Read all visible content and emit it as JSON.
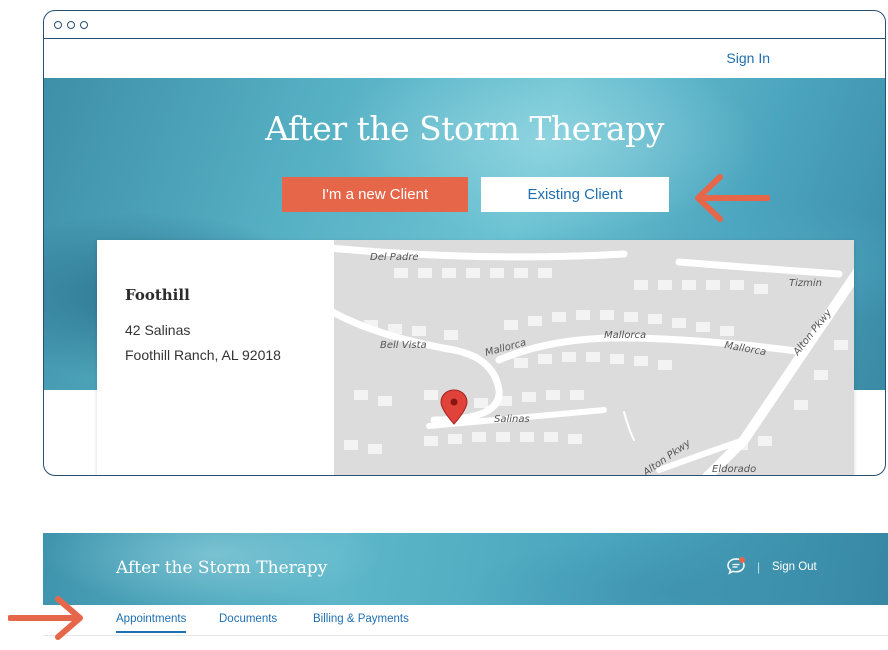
{
  "browser": {
    "topbar": {
      "sign_in": "Sign In"
    },
    "hero": {
      "title": "After the Storm Therapy",
      "new_client_label": "I'm a new Client",
      "existing_client_label": "Existing Client"
    },
    "location": {
      "name": "Foothill",
      "address_line1": "42 Salinas",
      "address_line2": "Foothill Ranch, AL 92018"
    },
    "map": {
      "streets": [
        "Del Padre",
        "Tizmin",
        "Alton Pkwy",
        "Bell Vista",
        "Mallorca",
        "Mallorca",
        "Mallorca",
        "Salinas",
        "Alton Pkwy",
        "Eldorado"
      ]
    }
  },
  "app": {
    "header": {
      "title": "After the Storm Therapy",
      "separator": "|",
      "sign_out": "Sign Out"
    },
    "tabs": [
      "Appointments",
      "Documents",
      "Billing & Payments"
    ]
  },
  "colors": {
    "accent": "#e6664a",
    "link": "#1f6fb2",
    "frame": "#2a4f73",
    "hero": "#56b0c4"
  }
}
